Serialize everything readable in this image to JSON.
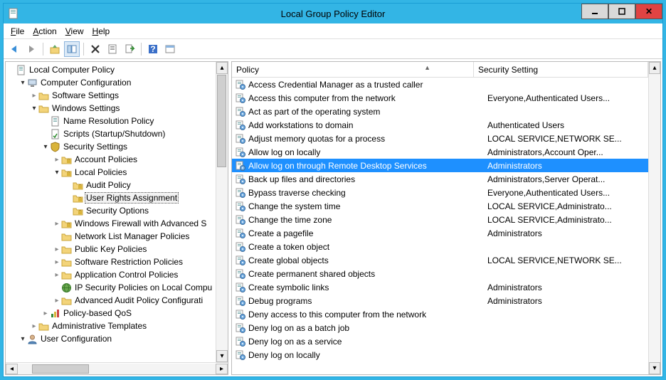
{
  "titlebar": {
    "title": "Local Group Policy Editor"
  },
  "menu": {
    "file": "File",
    "action": "Action",
    "view": "View",
    "help": "Help"
  },
  "tree": {
    "root": "Local Computer Policy",
    "cc": "Computer Configuration",
    "ss": "Software Settings",
    "ws": "Windows Settings",
    "nrp": "Name Resolution Policy",
    "scripts": "Scripts (Startup/Shutdown)",
    "sec": "Security Settings",
    "ap": "Account Policies",
    "lp": "Local Policies",
    "audit": "Audit Policy",
    "ura": "User Rights Assignment",
    "so": "Security Options",
    "wfw": "Windows Firewall with Advanced S",
    "nlm": "Network List Manager Policies",
    "pkp": "Public Key Policies",
    "srp": "Software Restriction Policies",
    "acp": "Application Control Policies",
    "ipsec": "IP Security Policies on Local Compu",
    "aapc": "Advanced Audit Policy Configurati",
    "pbqos": "Policy-based QoS",
    "at": "Administrative Templates",
    "uc": "User Configuration"
  },
  "cols": {
    "policy": "Policy",
    "setting": "Security Setting"
  },
  "rows": [
    {
      "p": "Access Credential Manager as a trusted caller",
      "s": ""
    },
    {
      "p": "Access this computer from the network",
      "s": "Everyone,Authenticated Users..."
    },
    {
      "p": "Act as part of the operating system",
      "s": ""
    },
    {
      "p": "Add workstations to domain",
      "s": "Authenticated Users"
    },
    {
      "p": "Adjust memory quotas for a process",
      "s": "LOCAL SERVICE,NETWORK SE..."
    },
    {
      "p": "Allow log on locally",
      "s": "Administrators,Account Oper..."
    },
    {
      "p": "Allow log on through Remote Desktop Services",
      "s": "Administrators",
      "sel": true
    },
    {
      "p": "Back up files and directories",
      "s": "Administrators,Server Operat..."
    },
    {
      "p": "Bypass traverse checking",
      "s": "Everyone,Authenticated Users..."
    },
    {
      "p": "Change the system time",
      "s": "LOCAL SERVICE,Administrato..."
    },
    {
      "p": "Change the time zone",
      "s": "LOCAL SERVICE,Administrato..."
    },
    {
      "p": "Create a pagefile",
      "s": "Administrators"
    },
    {
      "p": "Create a token object",
      "s": ""
    },
    {
      "p": "Create global objects",
      "s": "LOCAL SERVICE,NETWORK SE..."
    },
    {
      "p": "Create permanent shared objects",
      "s": ""
    },
    {
      "p": "Create symbolic links",
      "s": "Administrators"
    },
    {
      "p": "Debug programs",
      "s": "Administrators"
    },
    {
      "p": "Deny access to this computer from the network",
      "s": ""
    },
    {
      "p": "Deny log on as a batch job",
      "s": ""
    },
    {
      "p": "Deny log on as a service",
      "s": ""
    },
    {
      "p": "Deny log on locally",
      "s": ""
    }
  ]
}
